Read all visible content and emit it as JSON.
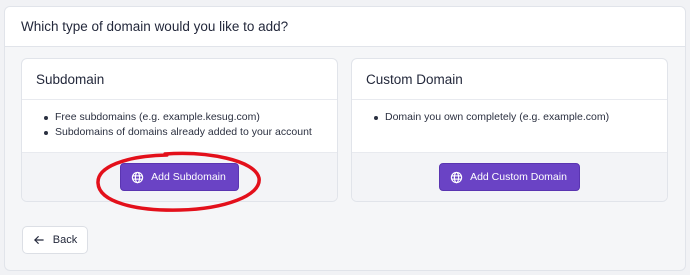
{
  "header": {
    "title": "Which type of domain would you like to add?"
  },
  "cards": [
    {
      "title": "Subdomain",
      "bullets": [
        "Free subdomains (e.g. example.kesug.com)",
        "Subdomains of domains already added to your account"
      ],
      "button_label": "Add Subdomain",
      "button_icon": "globe-icon"
    },
    {
      "title": "Custom Domain",
      "bullets": [
        "Domain you own completely (e.g. example.com)"
      ],
      "button_label": "Add Custom Domain",
      "button_icon": "globe-icon"
    }
  ],
  "back": {
    "label": "Back",
    "icon": "arrow-left-icon"
  },
  "colors": {
    "primary": "#6a43c5",
    "annotation": "#e3101b"
  }
}
